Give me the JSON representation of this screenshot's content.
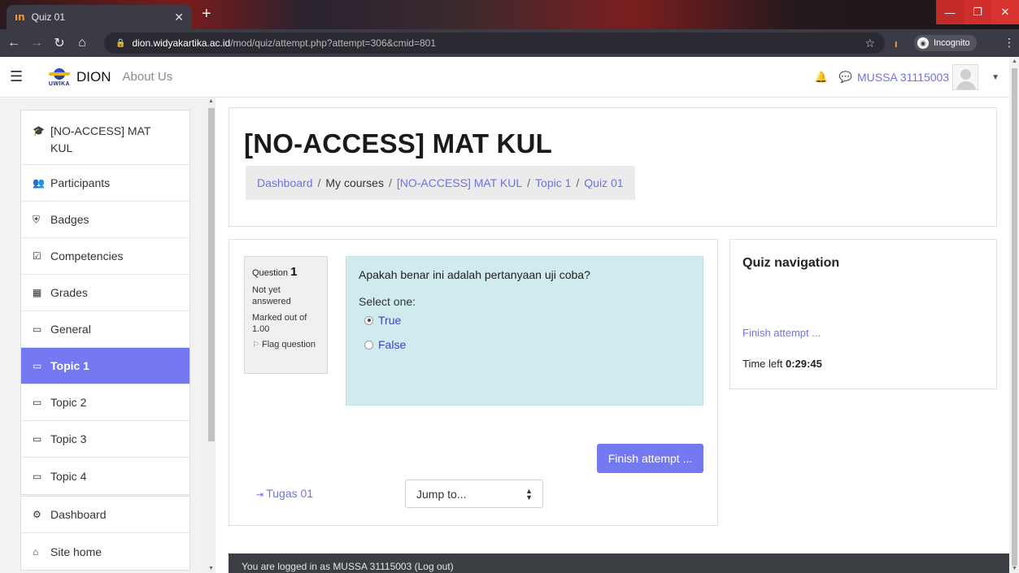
{
  "browser": {
    "tab_title": "Quiz 01",
    "tab_favicon": "ın",
    "url_host": "dion.widyakartika.ac.id",
    "url_path": "/mod/quiz/attempt.php?attempt=306&cmid=801",
    "incognito_label": "Incognito"
  },
  "navbar": {
    "brand": "DION",
    "logo_text": "UWIKA",
    "about": "About Us",
    "username": "MUSSA 31115003"
  },
  "sidebar": {
    "items": [
      {
        "label": "[NO-ACCESS] MAT KUL",
        "icon": "graduation-cap-icon",
        "glyph": "🎓"
      },
      {
        "label": "Participants",
        "icon": "users-icon",
        "glyph": "👥"
      },
      {
        "label": "Badges",
        "icon": "shield-icon",
        "glyph": "⛨"
      },
      {
        "label": "Competencies",
        "icon": "checkbox-icon",
        "glyph": "☑"
      },
      {
        "label": "Grades",
        "icon": "table-icon",
        "glyph": "▦"
      },
      {
        "label": "General",
        "icon": "folder-icon",
        "glyph": "▭"
      },
      {
        "label": "Topic 1",
        "icon": "folder-icon",
        "glyph": "▭"
      },
      {
        "label": "Topic 2",
        "icon": "folder-icon",
        "glyph": "▭"
      },
      {
        "label": "Topic 3",
        "icon": "folder-icon",
        "glyph": "▭"
      },
      {
        "label": "Topic 4",
        "icon": "folder-icon",
        "glyph": "▭"
      },
      {
        "label": "Dashboard",
        "icon": "dashboard-icon",
        "glyph": "⚙"
      },
      {
        "label": "Site home",
        "icon": "home-icon",
        "glyph": "⌂"
      }
    ],
    "active_item": "Topic 1"
  },
  "header": {
    "title": "[NO-ACCESS] MAT KUL",
    "breadcrumb": {
      "dashboard": "Dashboard",
      "my_courses": "My courses",
      "course": "[NO-ACCESS] MAT KUL",
      "topic": "Topic 1",
      "quiz": "Quiz 01",
      "separator": "/"
    }
  },
  "question": {
    "label": "Question",
    "number": "1",
    "state": "Not yet answered",
    "mark": "Marked out of 1.00",
    "flag_label": "Flag question",
    "text": "Apakah benar ini adalah pertanyaan uji coba?",
    "prompt": "Select one:",
    "options": [
      "True",
      "False"
    ],
    "selected": "True"
  },
  "quiz_actions": {
    "finish_button": "Finish attempt ...",
    "prev_link": "Tugas 01",
    "jump_placeholder": "Jump to..."
  },
  "quiz_nav": {
    "title": "Quiz navigation",
    "finish_link": "Finish attempt ...",
    "time_label": "Time left",
    "time_value": "0:29:45"
  },
  "footer": {
    "text": "You are logged in as MUSSA 31115003 (Log out)"
  },
  "colors": {
    "accent": "#7479f2",
    "link": "#6e72e8",
    "question_bg": "#cfebee"
  }
}
